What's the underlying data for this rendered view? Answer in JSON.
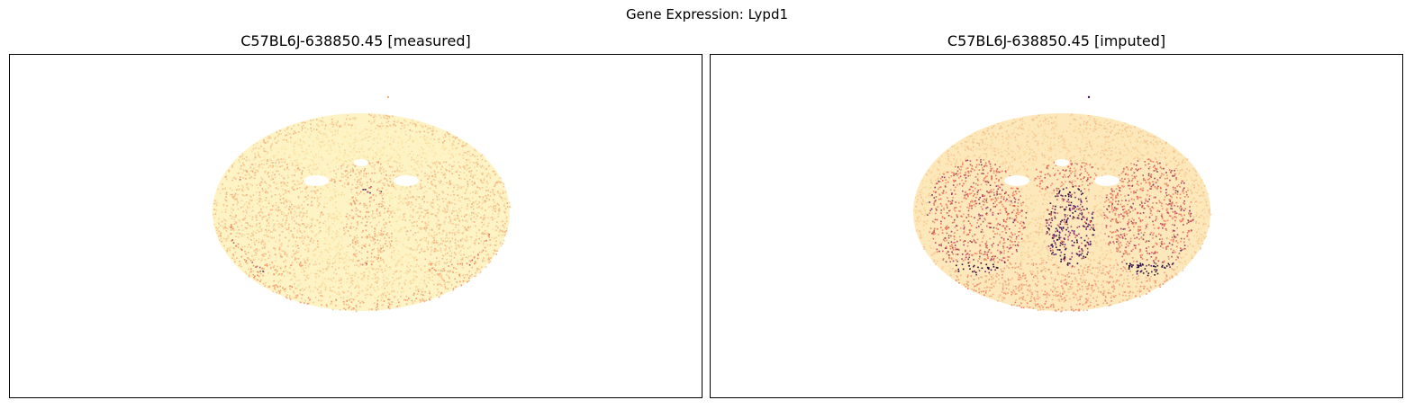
{
  "figure": {
    "title": "Gene Expression: Lypd1"
  },
  "panels": [
    {
      "id": "measured",
      "title": "C57BL6J-638850.45 [measured]",
      "colormap": "magma_r",
      "colors": {
        "background": "#ffffff",
        "low": "#fcefb0",
        "mid": "#f08a62",
        "high": "#5b1e6e",
        "peak": "#2a0b3c"
      }
    },
    {
      "id": "imputed",
      "title": "C57BL6J-638850.45 [imputed]",
      "colormap": "magma_r",
      "colors": {
        "background": "#ffffff",
        "low": "#fbe0a3",
        "mid": "#ec6d58",
        "high": "#5b1e6e",
        "peak": "#1e0a2e"
      }
    }
  ]
}
